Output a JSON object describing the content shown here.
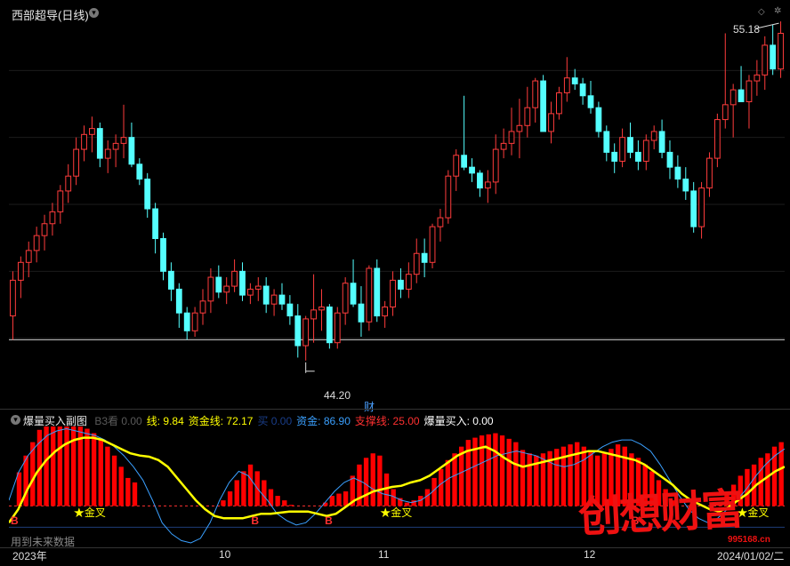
{
  "window": {
    "title": "西部超导(日线)"
  },
  "price": {
    "high_label": "55.18",
    "low_label": "44.20",
    "event_marker": "财",
    "yrange": [
      43.0,
      56.5
    ],
    "ref_line": 45.2,
    "candles": [
      [
        46.0,
        47.5,
        45.2,
        47.2
      ],
      [
        47.2,
        48.0,
        46.6,
        47.8
      ],
      [
        47.8,
        48.5,
        47.3,
        48.2
      ],
      [
        48.2,
        49.0,
        47.8,
        48.7
      ],
      [
        48.7,
        49.4,
        48.2,
        49.1
      ],
      [
        49.1,
        49.8,
        48.7,
        49.5
      ],
      [
        49.5,
        50.4,
        49.1,
        50.2
      ],
      [
        50.2,
        51.1,
        49.8,
        50.7
      ],
      [
        50.7,
        52.0,
        50.4,
        51.6
      ],
      [
        51.6,
        52.4,
        51.2,
        52.1
      ],
      [
        52.1,
        52.7,
        51.5,
        52.3
      ],
      [
        52.3,
        52.5,
        51.0,
        51.3
      ],
      [
        51.3,
        51.9,
        50.8,
        51.6
      ],
      [
        51.6,
        52.1,
        51.0,
        51.8
      ],
      [
        51.8,
        53.1,
        51.3,
        52.0
      ],
      [
        52.0,
        52.5,
        51.0,
        51.1
      ],
      [
        51.1,
        51.3,
        50.4,
        50.6
      ],
      [
        50.6,
        50.8,
        49.3,
        49.6
      ],
      [
        49.6,
        49.8,
        48.1,
        48.6
      ],
      [
        48.6,
        48.8,
        47.2,
        47.5
      ],
      [
        47.5,
        47.8,
        46.5,
        46.9
      ],
      [
        46.9,
        47.1,
        45.6,
        46.1
      ],
      [
        46.1,
        46.3,
        45.2,
        45.5
      ],
      [
        45.5,
        46.3,
        45.3,
        46.1
      ],
      [
        46.1,
        46.9,
        45.7,
        46.5
      ],
      [
        46.5,
        47.6,
        46.1,
        47.3
      ],
      [
        47.3,
        47.7,
        46.6,
        46.8
      ],
      [
        46.8,
        47.3,
        46.4,
        47.0
      ],
      [
        47.0,
        47.9,
        46.8,
        47.5
      ],
      [
        47.5,
        47.8,
        46.5,
        46.7
      ],
      [
        46.7,
        47.1,
        46.4,
        46.9
      ],
      [
        46.9,
        47.3,
        46.5,
        47.0
      ],
      [
        47.0,
        47.3,
        46.1,
        46.4
      ],
      [
        46.4,
        46.9,
        46.0,
        46.7
      ],
      [
        46.7,
        47.1,
        46.2,
        46.4
      ],
      [
        46.4,
        46.7,
        45.7,
        46.0
      ],
      [
        46.0,
        46.4,
        44.6,
        45.0
      ],
      [
        45.0,
        46.0,
        44.5,
        45.9
      ],
      [
        45.9,
        47.4,
        45.1,
        46.2
      ],
      [
        46.2,
        46.9,
        45.5,
        46.3
      ],
      [
        46.3,
        46.4,
        44.9,
        45.1
      ],
      [
        45.1,
        46.3,
        44.9,
        46.1
      ],
      [
        46.1,
        47.3,
        45.7,
        47.1
      ],
      [
        47.1,
        47.9,
        46.3,
        46.4
      ],
      [
        46.4,
        47.0,
        45.3,
        45.8
      ],
      [
        45.8,
        47.7,
        45.5,
        47.6
      ],
      [
        47.6,
        47.9,
        45.8,
        46.0
      ],
      [
        46.0,
        46.5,
        45.6,
        46.3
      ],
      [
        46.3,
        47.5,
        46.0,
        47.2
      ],
      [
        47.2,
        47.6,
        46.6,
        46.9
      ],
      [
        46.9,
        47.8,
        46.6,
        47.4
      ],
      [
        47.4,
        48.6,
        47.1,
        48.1
      ],
      [
        48.1,
        48.6,
        47.3,
        47.8
      ],
      [
        47.8,
        49.1,
        47.6,
        49.0
      ],
      [
        49.0,
        49.6,
        48.5,
        49.3
      ],
      [
        49.3,
        50.9,
        49.1,
        50.7
      ],
      [
        50.7,
        51.6,
        50.2,
        51.4
      ],
      [
        51.4,
        53.4,
        50.9,
        51.0
      ],
      [
        51.0,
        51.3,
        50.5,
        50.8
      ],
      [
        50.8,
        50.9,
        50.0,
        50.3
      ],
      [
        50.3,
        50.9,
        49.8,
        50.5
      ],
      [
        50.5,
        52.1,
        50.1,
        51.6
      ],
      [
        51.6,
        52.3,
        51.3,
        51.8
      ],
      [
        51.8,
        53.0,
        51.4,
        52.2
      ],
      [
        52.2,
        53.3,
        51.3,
        52.4
      ],
      [
        52.4,
        53.7,
        52.0,
        53.0
      ],
      [
        53.0,
        54.0,
        52.5,
        53.9
      ],
      [
        53.9,
        54.1,
        52.2,
        52.2
      ],
      [
        52.2,
        53.2,
        51.8,
        52.8
      ],
      [
        52.8,
        53.7,
        52.6,
        53.5
      ],
      [
        53.5,
        54.7,
        53.2,
        54.0
      ],
      [
        54.0,
        54.3,
        53.6,
        53.8
      ],
      [
        53.8,
        54.0,
        53.1,
        53.4
      ],
      [
        53.4,
        53.9,
        52.8,
        53.0
      ],
      [
        53.0,
        53.2,
        52.0,
        52.2
      ],
      [
        52.2,
        52.4,
        51.2,
        51.5
      ],
      [
        51.5,
        51.8,
        50.8,
        51.2
      ],
      [
        51.2,
        52.3,
        51.0,
        52.0
      ],
      [
        52.0,
        52.5,
        51.3,
        51.5
      ],
      [
        51.5,
        51.9,
        50.9,
        51.2
      ],
      [
        51.2,
        52.1,
        50.9,
        51.9
      ],
      [
        51.9,
        52.4,
        51.6,
        52.2
      ],
      [
        52.2,
        52.6,
        51.3,
        51.5
      ],
      [
        51.5,
        51.9,
        50.6,
        51.0
      ],
      [
        51.0,
        51.4,
        50.3,
        50.6
      ],
      [
        50.6,
        51.0,
        49.9,
        50.2
      ],
      [
        50.2,
        50.5,
        48.8,
        49.0
      ],
      [
        49.0,
        50.5,
        48.6,
        50.3
      ],
      [
        50.3,
        51.5,
        50.0,
        51.3
      ],
      [
        51.3,
        52.8,
        51.0,
        52.6
      ],
      [
        52.6,
        55.5,
        52.3,
        53.1
      ],
      [
        53.1,
        53.8,
        52.0,
        53.6
      ],
      [
        53.6,
        54.4,
        53.2,
        53.2
      ],
      [
        53.2,
        54.1,
        52.3,
        53.9
      ],
      [
        53.9,
        54.6,
        53.4,
        54.1
      ],
      [
        54.1,
        55.4,
        53.6,
        55.1
      ],
      [
        55.1,
        55.8,
        54.1,
        54.3
      ],
      [
        54.3,
        55.9,
        54.0,
        55.5
      ]
    ]
  },
  "sub": {
    "title": "爆量买入副图",
    "legend": [
      {
        "text": "B3看 0.00",
        "color": "#5a5a5a"
      },
      {
        "text": "线: 9.84",
        "color": "#ffff00"
      },
      {
        "text": "资金线: 72.17",
        "color": "#ffff00"
      },
      {
        "text": "买 0.00",
        "color": "#1a3e8a"
      },
      {
        "text": "资金: 86.90",
        "color": "#3aa0ff"
      },
      {
        "text": "支撑线: 25.00",
        "color": "#ff3030"
      },
      {
        "text": "爆量买入: 0.00",
        "color": "#ffffff"
      }
    ],
    "gold_cross_label": "★金叉",
    "buy_marker": "B",
    "future_data_note": "用到未来数据",
    "yrange": [
      -12,
      96
    ],
    "support_line": 25,
    "zero_line": 6,
    "bars": [
      20,
      55,
      70,
      82,
      93,
      99,
      100,
      100,
      100,
      99,
      98,
      94,
      90,
      85,
      78,
      70,
      60,
      50,
      46,
      20,
      10,
      6,
      6,
      6,
      6,
      8,
      8,
      10,
      12,
      14,
      20,
      30,
      38,
      48,
      56,
      62,
      56,
      48,
      40,
      34,
      30,
      26,
      20,
      12,
      8,
      20,
      28,
      34,
      36,
      38,
      52,
      62,
      68,
      72,
      70,
      54,
      40,
      32,
      28,
      30,
      34,
      40,
      50,
      58,
      66,
      72,
      78,
      84,
      86,
      88,
      89,
      90,
      88,
      85,
      82,
      75,
      72,
      70,
      72,
      74,
      76,
      78,
      80,
      82,
      78,
      74,
      70,
      72,
      76,
      80,
      78,
      72,
      68,
      62,
      56,
      48,
      40,
      30,
      22,
      14,
      8,
      6,
      10,
      20,
      28,
      36,
      44,
      52,
      58,
      62,
      68,
      72,
      78,
      82
    ],
    "yellow": [
      10,
      22,
      40,
      55,
      66,
      74,
      80,
      84,
      86,
      86,
      84,
      80,
      76,
      72,
      70,
      69,
      66,
      60,
      50,
      40,
      30,
      22,
      16,
      14,
      14,
      14,
      16,
      18,
      18,
      19,
      20,
      20,
      20,
      18,
      16,
      18,
      24,
      30,
      34,
      38,
      40,
      42,
      43,
      46,
      48,
      52,
      58,
      64,
      70,
      74,
      76,
      78,
      74,
      68,
      63,
      60,
      62,
      64,
      66,
      68,
      70,
      72,
      74,
      74,
      72,
      70,
      68,
      66,
      62,
      56,
      50,
      44,
      36,
      30,
      26,
      22,
      20,
      24,
      30,
      36,
      44,
      50,
      56,
      60
    ],
    "blue": [
      30,
      55,
      70,
      80,
      88,
      92,
      94,
      92,
      90,
      88,
      84,
      78,
      70,
      60,
      48,
      30,
      10,
      0,
      -6,
      -8,
      -4,
      10,
      30,
      46,
      56,
      52,
      40,
      30,
      18,
      12,
      8,
      10,
      18,
      28,
      38,
      46,
      50,
      46,
      40,
      36,
      34,
      30,
      28,
      30,
      36,
      44,
      50,
      54,
      58,
      62,
      66,
      70,
      72,
      74,
      72,
      70,
      66,
      62,
      60,
      62,
      66,
      72,
      78,
      82,
      84,
      84,
      80,
      74,
      62,
      48,
      34,
      22,
      14,
      10,
      14,
      22,
      30,
      40,
      52,
      62,
      70,
      76
    ],
    "gold_cross_positions": [
      0.095,
      0.49,
      0.95
    ],
    "buy_positions": [
      0.0,
      0.31,
      0.405,
      0.8
    ]
  },
  "x_axis": {
    "labels": [
      "2023年",
      "10",
      "11",
      "12",
      "2024/01/02/二"
    ]
  },
  "colors": {
    "up": "#ff3c3c",
    "down": "#54ffff",
    "bar": "#ff0000",
    "bg": "#000000"
  },
  "watermark": {
    "text": "创想财富",
    "url": "995168.cn"
  }
}
